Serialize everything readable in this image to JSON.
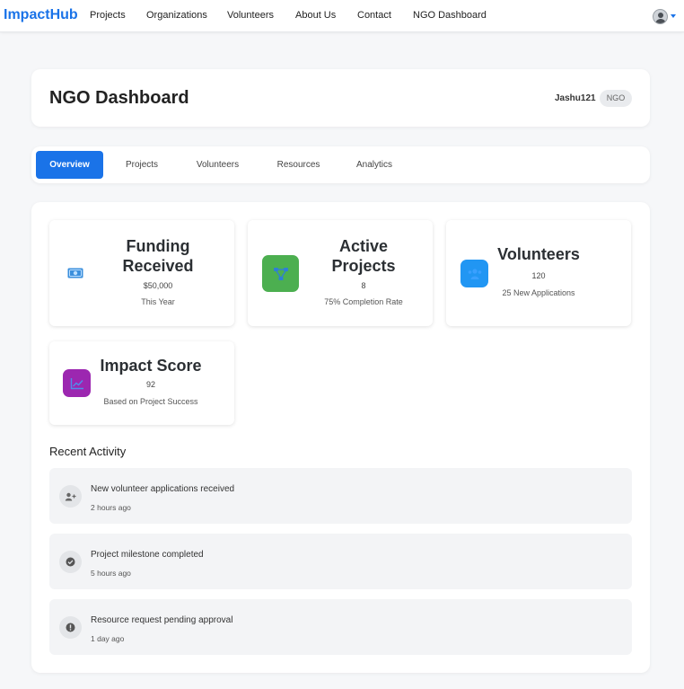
{
  "nav": {
    "brand": "ImpactHub",
    "links": [
      "Projects",
      "Organizations",
      "Volunteers",
      "About Us",
      "Contact",
      "NGO Dashboard"
    ],
    "avatar_icon": "user-avatar-icon"
  },
  "header": {
    "title": "NGO Dashboard",
    "username": "Jashu121",
    "role": "NGO"
  },
  "tabs": [
    "Overview",
    "Projects",
    "Volunteers",
    "Resources",
    "Analytics"
  ],
  "active_tab": "Overview",
  "stats": [
    {
      "title": "Funding Received",
      "value": "$50,000",
      "sub": "This Year",
      "icon": "money-icon",
      "icon_color": "#3b8fdc"
    },
    {
      "title": "Active Projects",
      "value": "8",
      "sub": "75% Completion Rate",
      "icon": "project-diagram-icon",
      "icon_color": "#4caf50"
    },
    {
      "title": "Volunteers",
      "value": "120",
      "sub": "25 New Applications",
      "icon": "users-icon",
      "icon_color": "#2196f3"
    },
    {
      "title": "Impact Score",
      "value": "92",
      "sub": "Based on Project Success",
      "icon": "chart-line-icon",
      "icon_color": "#9c27b0"
    }
  ],
  "recent_activity": {
    "title": "Recent Activity",
    "items": [
      {
        "text": "New volunteer applications received",
        "time": "2 hours ago",
        "icon": "user-plus-icon"
      },
      {
        "text": "Project milestone completed",
        "time": "5 hours ago",
        "icon": "check-circle-icon"
      },
      {
        "text": "Resource request pending approval",
        "time": "1 day ago",
        "icon": "info-circle-icon"
      }
    ]
  },
  "colors": {
    "accent": "#1a73e8",
    "page_bg": "#f6f7f9"
  }
}
